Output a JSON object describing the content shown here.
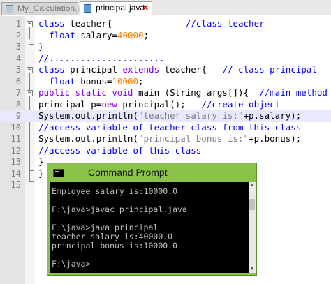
{
  "tabs": [
    {
      "label": "My_Calculation.java",
      "active": false
    },
    {
      "label": "principal.java",
      "active": true
    }
  ],
  "code_lines": [
    {
      "n": "1",
      "tokens": [
        [
          "kw2",
          "class "
        ],
        [
          "pl",
          "teacher{"
        ],
        [
          "pl",
          "              "
        ],
        [
          "cmt",
          "//class teacher"
        ]
      ]
    },
    {
      "n": "2",
      "tokens": [
        [
          "pl",
          "  "
        ],
        [
          "kw2",
          "float "
        ],
        [
          "pl",
          "salary="
        ],
        [
          "num",
          "40000"
        ],
        [
          "pl",
          ";"
        ]
      ]
    },
    {
      "n": "3",
      "tokens": [
        [
          "pl",
          "}"
        ]
      ]
    },
    {
      "n": "4",
      "tokens": [
        [
          "cmt",
          "//......................"
        ]
      ]
    },
    {
      "n": "5",
      "tokens": [
        [
          "kw2",
          "class "
        ],
        [
          "pl",
          "principal "
        ],
        [
          "kw",
          "extends "
        ],
        [
          "pl",
          "teacher{   "
        ],
        [
          "cmt",
          "// class principal"
        ]
      ]
    },
    {
      "n": "6",
      "tokens": [
        [
          "pl",
          "  "
        ],
        [
          "kw2",
          "float "
        ],
        [
          "pl",
          "bonus="
        ],
        [
          "num",
          "10000"
        ],
        [
          "pl",
          ";"
        ]
      ]
    },
    {
      "n": "7",
      "tokens": [
        [
          "kw",
          "public static void "
        ],
        [
          "pl",
          "main (String args[]){  "
        ],
        [
          "cmt",
          "//main method"
        ]
      ]
    },
    {
      "n": "8",
      "tokens": [
        [
          "pl",
          "principal p="
        ],
        [
          "kw",
          "new "
        ],
        [
          "pl",
          "principal();   "
        ],
        [
          "cmt",
          "//create object"
        ]
      ]
    },
    {
      "n": "9",
      "tokens": [
        [
          "pl",
          "System.out.println("
        ],
        [
          "str",
          "\"teacher salary is:\""
        ],
        [
          "pl",
          "+p.salary);"
        ]
      ]
    },
    {
      "n": "10",
      "tokens": [
        [
          "cmt",
          "//access variable of teacher class from this class"
        ]
      ]
    },
    {
      "n": "11",
      "tokens": [
        [
          "pl",
          "System.out.println("
        ],
        [
          "str",
          "\"principal bonus is:\""
        ],
        [
          "pl",
          "+p.bonus);"
        ]
      ]
    },
    {
      "n": "12",
      "tokens": [
        [
          "cmt",
          "//access variable of this class"
        ]
      ]
    },
    {
      "n": "13",
      "tokens": [
        [
          "pl",
          "}"
        ]
      ]
    },
    {
      "n": "14",
      "tokens": [
        [
          "pl",
          "}"
        ]
      ]
    },
    {
      "n": "15",
      "tokens": []
    }
  ],
  "highlighted_line": "9",
  "command_prompt": {
    "title": "Command Prompt",
    "lines": [
      "Employee salary is:10000.0",
      "",
      "F:\\java>javac principal.java",
      "",
      "F:\\java>java principal",
      "teacher salary is:40000.0",
      "principal bonus is:10000.0",
      "",
      "F:\\java>"
    ]
  },
  "colors": {
    "keyword": "#8000ff",
    "type": "#0000ff",
    "number": "#ff8000",
    "comment": "#0000ff",
    "string": "#808080",
    "console_window": "#8bc34a"
  }
}
